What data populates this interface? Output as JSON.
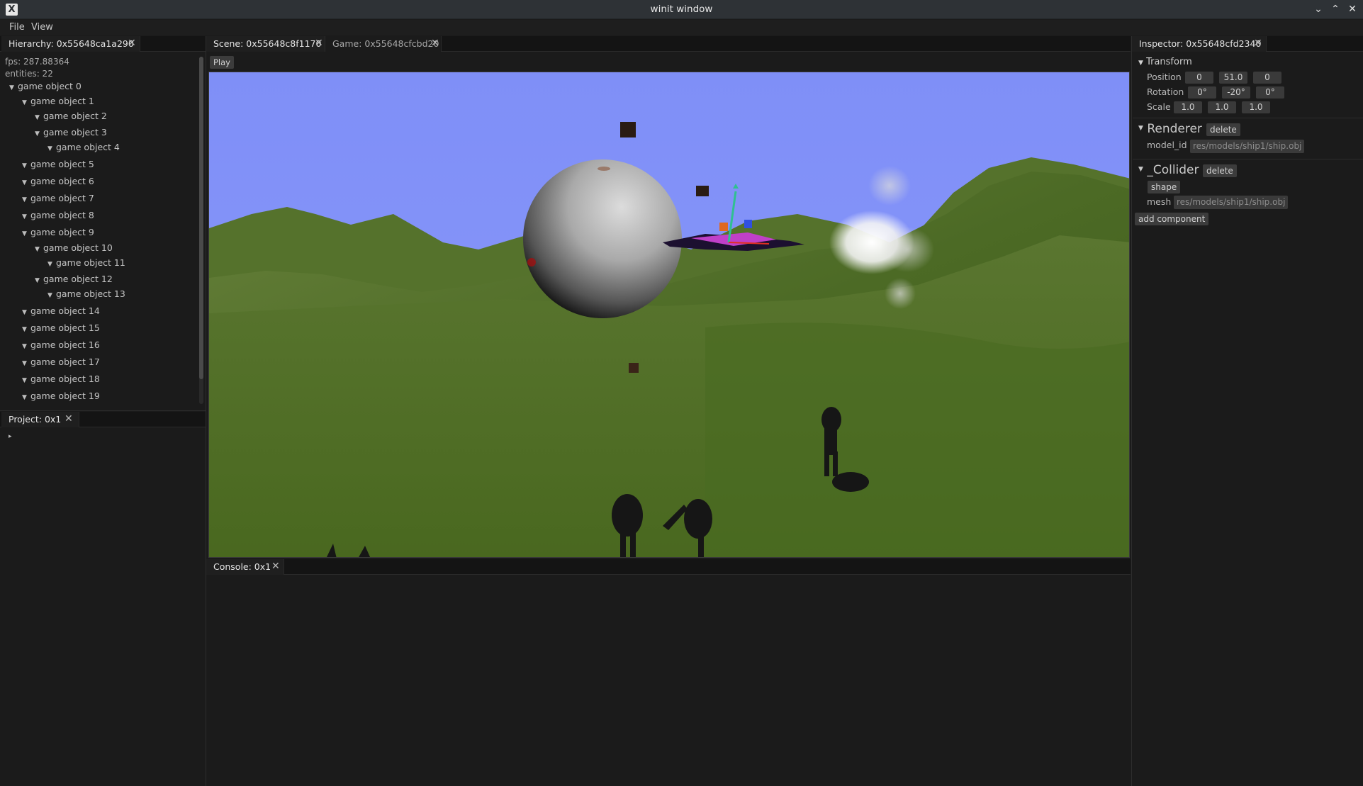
{
  "window": {
    "title": "winit window",
    "app_icon": "X"
  },
  "menu": {
    "file": "File",
    "view": "View"
  },
  "hierarchy": {
    "tab_label": "Hierarchy: 0x55648ca1a290",
    "fps": "fps: 287.88364",
    "entities": "entities: 22",
    "items": [
      {
        "label": "game object 0"
      },
      {
        "label": "game object 1"
      },
      {
        "label": "game object 2"
      },
      {
        "label": "game object 3"
      },
      {
        "label": "game object 4"
      },
      {
        "label": "game object 5"
      },
      {
        "label": "game object 6"
      },
      {
        "label": "game object 7"
      },
      {
        "label": "game object 8"
      },
      {
        "label": "game object 9"
      },
      {
        "label": "game object 10"
      },
      {
        "label": "game object 11"
      },
      {
        "label": "game object 12"
      },
      {
        "label": "game object 13"
      },
      {
        "label": "game object 14"
      },
      {
        "label": "game object 15"
      },
      {
        "label": "game object 16"
      },
      {
        "label": "game object 17"
      },
      {
        "label": "game object 18"
      },
      {
        "label": "game object 19"
      }
    ]
  },
  "project": {
    "tab_label": "Project: 0x1"
  },
  "center": {
    "scene_tab": "Scene: 0x55648c8f1170",
    "game_tab": "Game: 0x55648cfcbd20",
    "play_button": "Play"
  },
  "console": {
    "tab_label": "Console: 0x1"
  },
  "inspector": {
    "tab_label": "Inspector: 0x55648cfd2340",
    "transform": {
      "title": "Transform",
      "position_label": "Position",
      "position": [
        "0",
        "51.0",
        "0"
      ],
      "rotation_label": "Rotation",
      "rotation": [
        "0°",
        "-20°",
        "0°"
      ],
      "scale_label": "Scale",
      "scale": [
        "1.0",
        "1.0",
        "1.0"
      ]
    },
    "renderer": {
      "title": "Renderer",
      "delete_label": "delete",
      "model_id_label": "model_id",
      "model_id_value": "res/models/ship1/ship.obj"
    },
    "collider": {
      "title": "_Collider",
      "delete_label": "delete",
      "shape_label": "shape",
      "mesh_label": "mesh",
      "mesh_value": "res/models/ship1/ship.obj"
    },
    "add_component_label": "add component"
  },
  "colors": {
    "sky": "#8090f8",
    "terrain": "#4a6a22",
    "panel": "#1b1b1b",
    "tabstrip": "#141414"
  },
  "icons": {
    "close": "close-icon",
    "caret": "caret-down-icon",
    "minimize": "chevron-down-icon",
    "maximize": "chevron-up-icon"
  }
}
